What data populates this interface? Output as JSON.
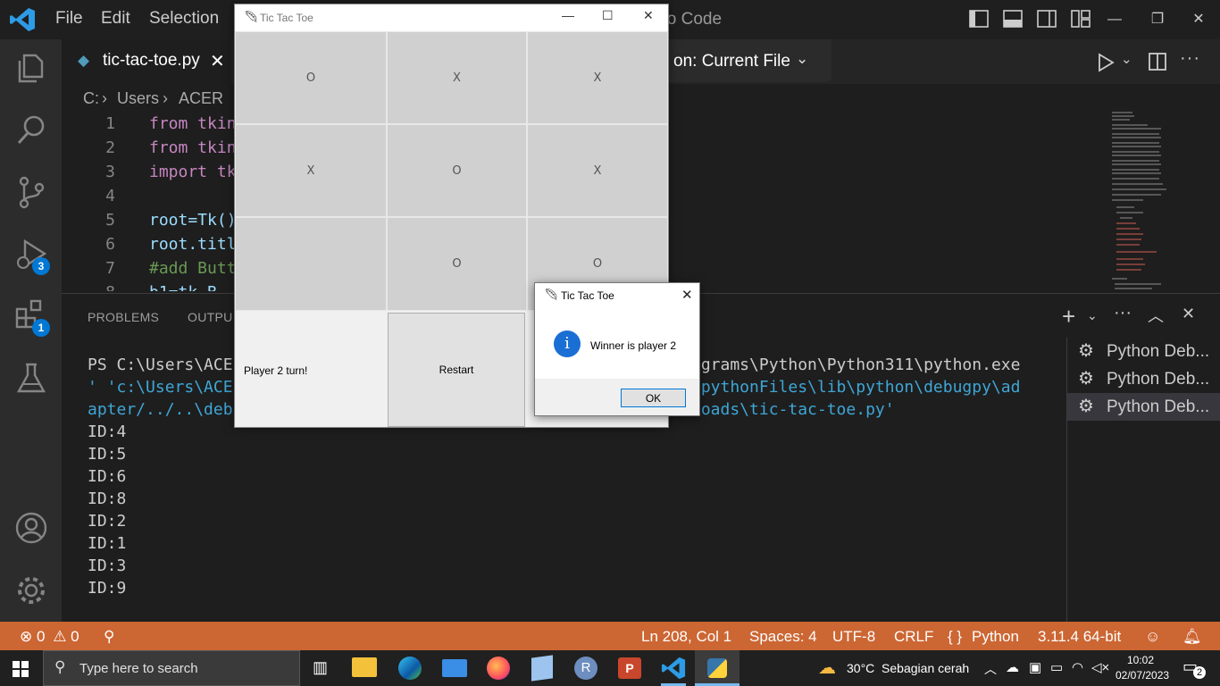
{
  "titlebar": {
    "menu": [
      "File",
      "Edit",
      "Selection"
    ],
    "title_fragment": "dio Code"
  },
  "editor": {
    "tab_label": "tic-tac-toe.py",
    "run_config": "on: Current File",
    "breadcrumb": [
      "C:",
      "Users",
      "ACER"
    ],
    "lines": [
      {
        "no": "1",
        "text": "from tkin"
      },
      {
        "no": "2",
        "text": "from tkin"
      },
      {
        "no": "3",
        "text": "import tk"
      },
      {
        "no": "4",
        "text": ""
      },
      {
        "no": "5",
        "text": "root=Tk()"
      },
      {
        "no": "6",
        "text": "root.titl"
      },
      {
        "no": "7",
        "text": "#add Butt"
      },
      {
        "no": "8",
        "text": "b1=tk.B"
      }
    ]
  },
  "activity": {
    "debug_badge": "3",
    "extensions_badge": "1"
  },
  "panel": {
    "tabs": [
      "PROBLEMS",
      "OUTPU"
    ],
    "terminal_left": [
      "PS C:\\Users\\ACE",
      "' 'c:\\Users\\ACE",
      "apter/../..\\deb"
    ],
    "terminal_right": [
      "ograms\\Python\\Python311\\python.exe",
      "\\pythonFiles\\lib\\python\\debugpy\\ad",
      "loads\\tic-tac-toe.py'"
    ],
    "ids": [
      "ID:4",
      "ID:5",
      "ID:6",
      "ID:8",
      "ID:2",
      "ID:1",
      "ID:3",
      "ID:9"
    ],
    "terminals": [
      "Python Deb...",
      "Python Deb...",
      "Python Deb..."
    ]
  },
  "statusbar": {
    "errors": "0",
    "warnings": "0",
    "position": "Ln 208, Col 1",
    "spaces": "Spaces: 4",
    "encoding": "UTF-8",
    "eol": "CRLF",
    "language": "Python",
    "interpreter": "3.11.4 64-bit"
  },
  "taskbar": {
    "search_placeholder": "Type here to search",
    "weather": "30°C  Sebagian cerah",
    "time": "10:02",
    "date": "02/07/2023",
    "notifications": "2"
  },
  "game": {
    "window_title": "Tic Tac Toe",
    "board": [
      "O",
      "X",
      "X",
      "X",
      "O",
      "X",
      "",
      "O",
      "O"
    ],
    "status": "Player 2 turn!",
    "restart_label": "Restart"
  },
  "dialog": {
    "title": "Tic Tac Toe",
    "message": "Winner is player 2",
    "ok_label": "OK"
  },
  "colors": {
    "statusbar": "#cc6633",
    "accent": "#0078d4",
    "keyword": "#c586c0"
  }
}
